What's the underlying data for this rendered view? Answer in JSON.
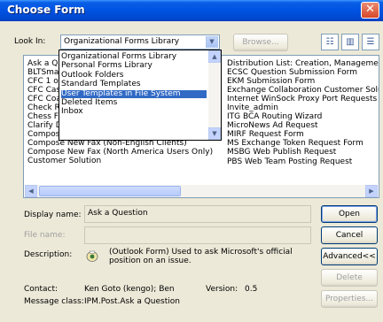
{
  "window": {
    "title": "Choose Form"
  },
  "look_in": {
    "label": "Look In:",
    "value": "Organizational Forms Library"
  },
  "browse_button": "Browse...",
  "view_buttons": [
    "large-icons",
    "details",
    "list"
  ],
  "dropdown": {
    "items": [
      "Organizational Forms Library",
      "Personal Forms Library",
      "Outlook Folders",
      "Standard Templates",
      "User Templates in File System",
      "Deleted Items",
      "Inbox"
    ],
    "selected": "User Templates in File System"
  },
  "forms_list": {
    "col1_partial": [
      "Ask a Qu",
      "BLTSmar",
      "CFC 1 on",
      "CFC Cas",
      "CFC Coa",
      "Check Re"
    ],
    "col1": [
      "Chess Form",
      "Clarify Down",
      "Compose New Fax (English Clients)",
      "Compose New Fax (Non-English Clients)",
      "Compose New Fax (North America Users Only)",
      "Customer Solution"
    ],
    "col2": [
      "Distribution List: Creation, Management N",
      "ECSC Question Submission Form",
      "EKM Submission Form",
      "Exchange Collaboration Customer Solution",
      "Internet WinSock Proxy Port Requests",
      "Invite_admin",
      "ITG BCA Routing Wizard",
      "MicroNews Ad Request",
      "MIRF Request Form",
      "MS Exchange Token Request Form",
      "MSBG Web Publish Request",
      "PBS Web Team Posting Request"
    ]
  },
  "display_name": {
    "label": "Display name:",
    "value": "Ask a Question"
  },
  "file_name": {
    "label": "File name:",
    "value": ""
  },
  "description": {
    "label": "Description:",
    "value": "(Outlook Form) Used to ask Microsoft's official position on an issue."
  },
  "contact": {
    "label": "Contact:",
    "value": "Ken Goto (kengo); Ben"
  },
  "version": {
    "label": "Version:",
    "value": "0.5"
  },
  "message_class": {
    "label": "Message class:",
    "value": "IPM.Post.Ask a Question"
  },
  "buttons": {
    "open": "Open",
    "cancel": "Cancel",
    "advanced": "Advanced<<",
    "delete": "Delete",
    "properties": "Properties..."
  },
  "icons": {
    "close": "close-icon",
    "message_class": "message-icon"
  }
}
